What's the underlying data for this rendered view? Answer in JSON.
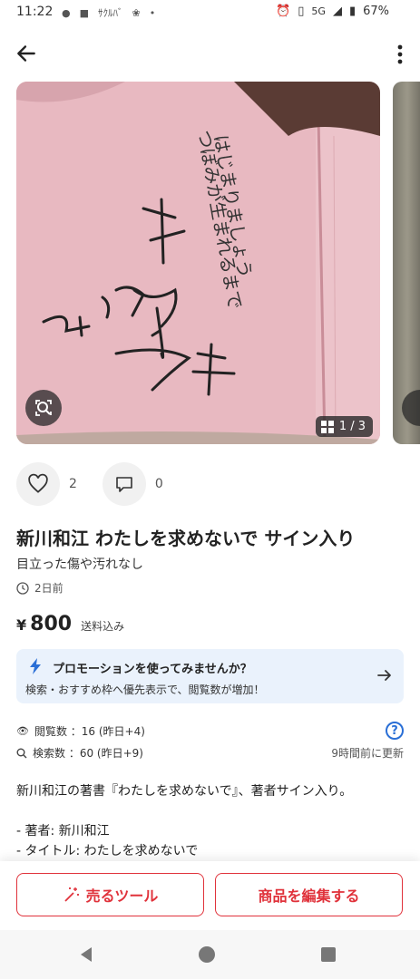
{
  "status_bar": {
    "time": "11:22",
    "network": "5G",
    "battery": "67%",
    "small_label": "ｻｸﾙﾊﾞ"
  },
  "gallery": {
    "counter": "1 / 3"
  },
  "likes": {
    "count": "2"
  },
  "comments": {
    "count": "0"
  },
  "item": {
    "title": "新川和江 わたしを求めないで サイン入り",
    "condition": "目立った傷や汚れなし",
    "posted_ago": "2日前",
    "price_symbol": "¥",
    "price": "800",
    "shipping": "送料込み"
  },
  "promo": {
    "title": "プロモーションを使ってみませんか？",
    "subtitle": "検索・おすすめ枠へ優先表示で、閲覧数が増加！"
  },
  "stats": {
    "views": "閲覧数 ：16 (昨日+4)",
    "searches": "検索数 ：60 (昨日+9)",
    "updated": "9時間前に更新"
  },
  "description": {
    "line1": "新川和江の著書『わたしを求めないで』、著者サイン入り。",
    "line2": "- 著者: 新川和江",
    "line3": "- タイトル: わたしを求めないで"
  },
  "buttons": {
    "sell_tools": "売るツール",
    "edit_item": "商品を編集する"
  },
  "colors": {
    "accent": "#e0323b",
    "link": "#2a6fd6",
    "promo_bg": "#eaf2fc"
  }
}
